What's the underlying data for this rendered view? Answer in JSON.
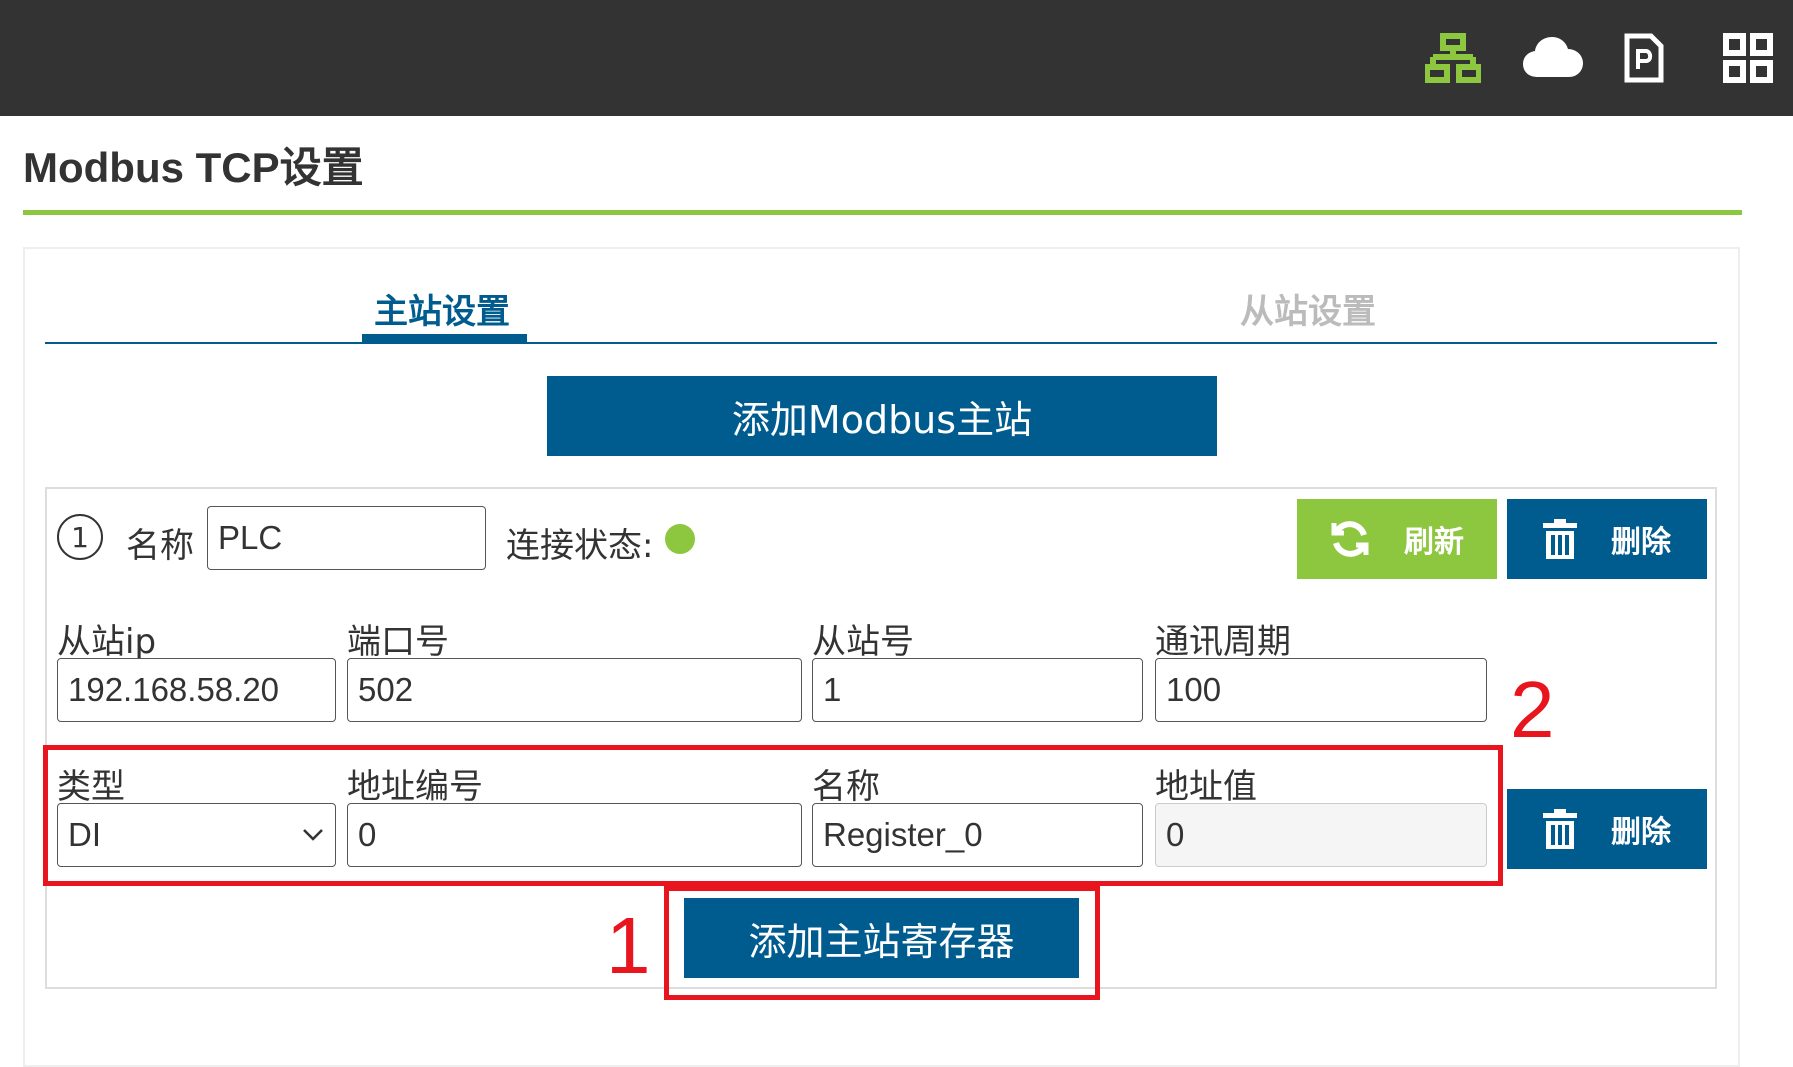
{
  "topbar": {
    "icons": [
      {
        "name": "network-icon",
        "color": "#8dc63f"
      },
      {
        "name": "cloud-icon",
        "color": "#ffffff"
      },
      {
        "name": "document-p-icon",
        "color": "#ffffff"
      },
      {
        "name": "grid-icon",
        "color": "#ffffff"
      }
    ]
  },
  "page": {
    "title": "Modbus TCP设置"
  },
  "tabs": [
    {
      "label": "主站设置",
      "active": true
    },
    {
      "label": "从站设置",
      "active": false
    }
  ],
  "add_master_button": "添加Modbus主站",
  "master": {
    "index": "1",
    "name_label": "名称",
    "name_value": "PLC",
    "status_label": "连接状态:",
    "status_color": "#8dc63f",
    "refresh_label": "刷新",
    "delete_label": "删除",
    "fields": {
      "slave_ip": {
        "label": "从站ip",
        "value": "192.168.58.20"
      },
      "port": {
        "label": "端口号",
        "value": "502"
      },
      "slave_id": {
        "label": "从站号",
        "value": "1"
      },
      "period": {
        "label": "通讯周期",
        "value": "100"
      }
    },
    "register": {
      "type_label": "类型",
      "type_value": "DI",
      "address_label": "地址编号",
      "address_value": "0",
      "name_label": "名称",
      "name_value": "Register_0",
      "value_label": "地址值",
      "value_value": "0",
      "delete_label": "删除"
    },
    "add_register_button": "添加主站寄存器"
  },
  "annotations": {
    "mark_1": "1",
    "mark_2": "2",
    "color": "#e8141e"
  },
  "colors": {
    "brand_blue": "#005b8f",
    "accent_green": "#8dc63f",
    "topbar": "#333333"
  }
}
